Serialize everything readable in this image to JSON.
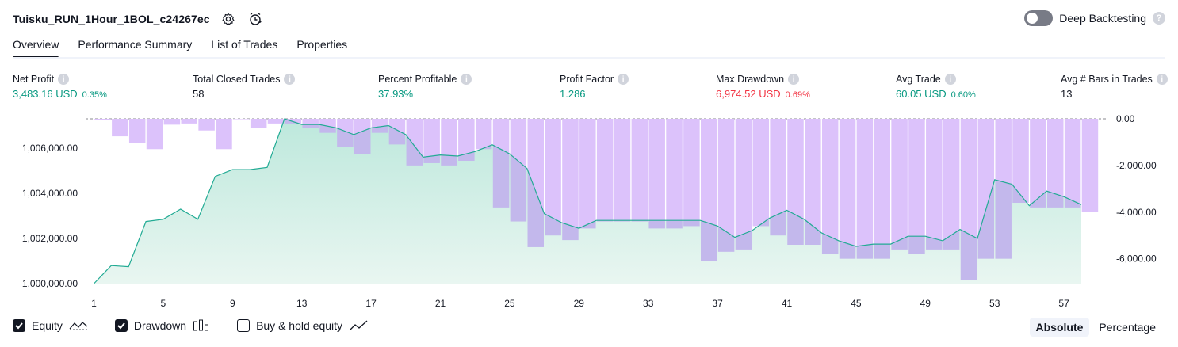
{
  "header": {
    "title": "Tuisku_RUN_1Hour_1BOL_c24267ec",
    "deep_backtesting_label": "Deep Backtesting",
    "deep_backtesting_on": false
  },
  "tabs": [
    "Overview",
    "Performance Summary",
    "List of Trades",
    "Properties"
  ],
  "active_tab": "Overview",
  "metrics": [
    {
      "label": "Net Profit",
      "value": "3,483.16 USD",
      "pct": "0.35%",
      "tone": "pos"
    },
    {
      "label": "Total Closed Trades",
      "value": "58",
      "pct": "",
      "tone": "neu"
    },
    {
      "label": "Percent Profitable",
      "value": "37.93%",
      "pct": "",
      "tone": "pos"
    },
    {
      "label": "Profit Factor",
      "value": "1.286",
      "pct": "",
      "tone": "pos"
    },
    {
      "label": "Max Drawdown",
      "value": "6,974.52 USD",
      "pct": "0.69%",
      "tone": "neg"
    },
    {
      "label": "Avg Trade",
      "value": "60.05 USD",
      "pct": "0.60%",
      "tone": "pos"
    },
    {
      "label": "Avg # Bars in Trades",
      "value": "13",
      "pct": "",
      "tone": "neu"
    }
  ],
  "legend": {
    "equity": "Equity",
    "drawdown": "Drawdown",
    "buy_hold": "Buy & hold equity",
    "equity_checked": true,
    "drawdown_checked": true,
    "buy_hold_checked": false
  },
  "modes": [
    "Absolute",
    "Percentage"
  ],
  "active_mode": "Absolute",
  "colors": {
    "equity_line": "#22ab94",
    "equity_fill_top": "#bde8dc",
    "equity_fill_bottom": "#e9f6f1",
    "drawdown_bar": "#dcc2fb",
    "drawdown_overlap": "#c3b8ec",
    "positive": "#089981",
    "negative": "#f23645"
  },
  "chart_data": {
    "type": "area",
    "x": [
      1,
      2,
      3,
      4,
      5,
      6,
      7,
      8,
      9,
      10,
      11,
      12,
      13,
      14,
      15,
      16,
      17,
      18,
      19,
      20,
      21,
      22,
      23,
      24,
      25,
      26,
      27,
      28,
      29,
      30,
      31,
      32,
      33,
      34,
      35,
      36,
      37,
      38,
      39,
      40,
      41,
      42,
      43,
      44,
      45,
      46,
      47,
      48,
      49,
      50,
      51,
      52,
      53,
      54,
      55,
      56,
      57,
      58,
      59
    ],
    "x_tick_labels": [
      "1",
      "5",
      "9",
      "13",
      "17",
      "21",
      "25",
      "29",
      "33",
      "37",
      "41",
      "45",
      "49",
      "53",
      "57"
    ],
    "left_axis": {
      "ylim": [
        1000000,
        1007300
      ],
      "tick_labels": [
        "1,000,000.00",
        "1,002,000.00",
        "1,004,000.00",
        "1,006,000.00"
      ],
      "tick_values": [
        1000000,
        1002000,
        1004000,
        1006000
      ]
    },
    "right_axis": {
      "ylim": [
        -7200,
        0
      ],
      "tick_labels": [
        "0.00",
        "-2,000.00",
        "-4,000.00",
        "-6,000.00"
      ],
      "tick_values": [
        0,
        -2000,
        -4000,
        -6000
      ]
    },
    "series": [
      {
        "name": "Equity",
        "values": [
          1000000,
          1000800,
          1000750,
          1002750,
          1002850,
          1003300,
          1002850,
          1004750,
          1005050,
          1005050,
          1005150,
          1007300,
          1007050,
          1007050,
          1006900,
          1006600,
          1006900,
          1007000,
          1006600,
          1005600,
          1005700,
          1005650,
          1005850,
          1006150,
          1005750,
          1005100,
          1003100,
          1002700,
          1002450,
          1002800,
          1002800,
          1002800,
          1002800,
          1002800,
          1002800,
          1002800,
          1002550,
          1002050,
          1002350,
          1002900,
          1003250,
          1002850,
          1002250,
          1001900,
          1001650,
          1001750,
          1001750,
          1002100,
          1002100,
          1001900,
          1002400,
          1002000,
          1004600,
          1004400,
          1003450,
          1004100,
          1003850,
          1003500
        ]
      },
      {
        "name": "Drawdown",
        "values": [
          -50,
          -750,
          -1050,
          -1300,
          -250,
          -200,
          -500,
          -1300,
          0,
          -400,
          -200,
          -200,
          -400,
          -600,
          -1200,
          -1500,
          -600,
          -1100,
          -2000,
          -1900,
          -2000,
          -1800,
          -1300,
          -3800,
          -4400,
          -5500,
          -5000,
          -5200,
          -4700,
          -4400,
          -4400,
          -4400,
          -4700,
          -4700,
          -4600,
          -6100,
          -5700,
          -5600,
          -4600,
          -5000,
          -5400,
          -5400,
          -5800,
          -6000,
          -6000,
          -6000,
          -5600,
          -5800,
          -5600,
          -5600,
          -6900,
          -6000,
          -6000,
          -3600,
          -3800,
          -3800,
          -3800,
          -4000
        ]
      }
    ]
  }
}
